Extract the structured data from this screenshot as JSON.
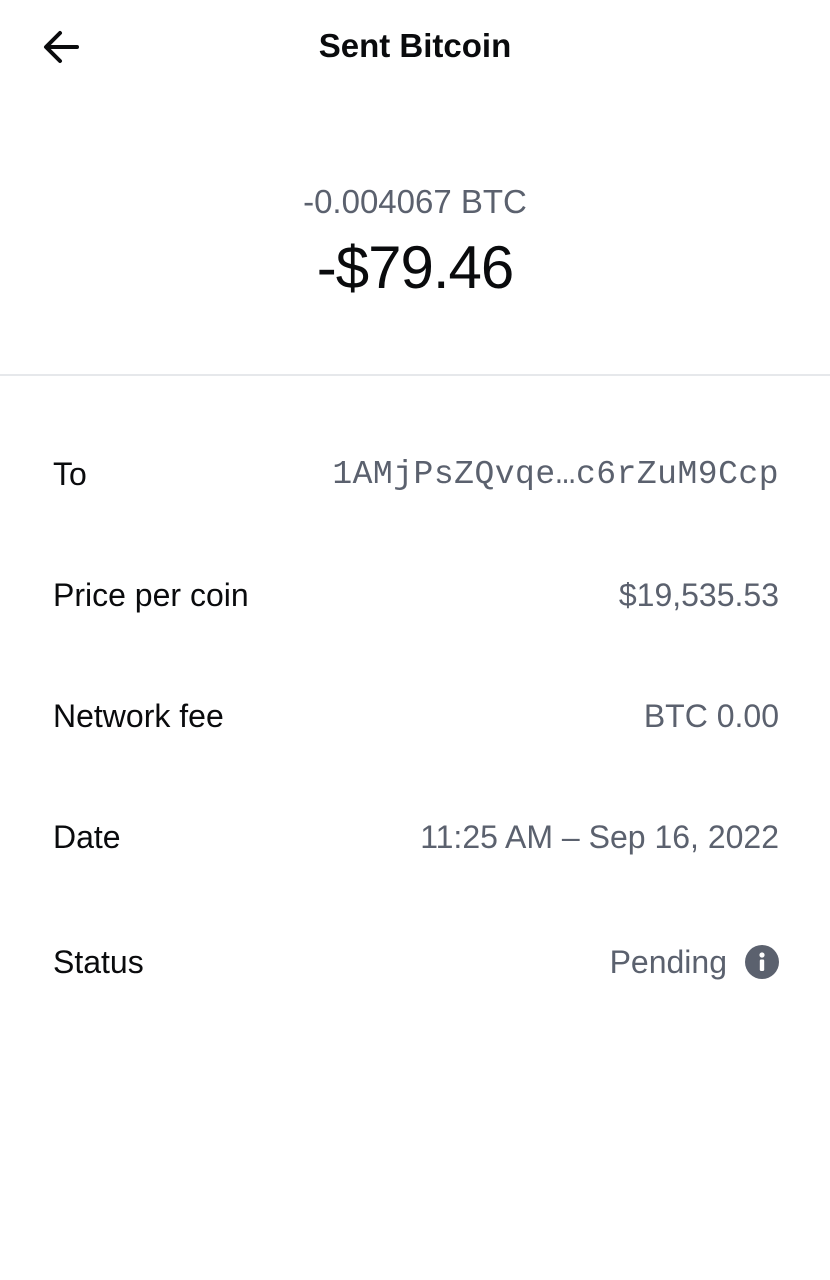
{
  "header": {
    "title": "Sent Bitcoin",
    "back_icon": "arrow-left-icon"
  },
  "amount": {
    "crypto": "-0.004067 BTC",
    "fiat": "-$79.46"
  },
  "details": {
    "to": {
      "label": "To",
      "value": "1AMjPsZQvqe…c6rZuM9Ccp"
    },
    "price": {
      "label": "Price per coin",
      "value": "$19,535.53"
    },
    "fee": {
      "label": "Network fee",
      "value": "BTC 0.00"
    },
    "date": {
      "label": "Date",
      "value": "11:25 AM – Sep 16, 2022"
    },
    "status": {
      "label": "Status",
      "value": "Pending",
      "icon": "info-icon"
    }
  },
  "colors": {
    "primary_text": "#0a0b0d",
    "secondary_text": "#5b616e",
    "divider": "#e6e8eb",
    "info_icon": "#5b616e"
  }
}
